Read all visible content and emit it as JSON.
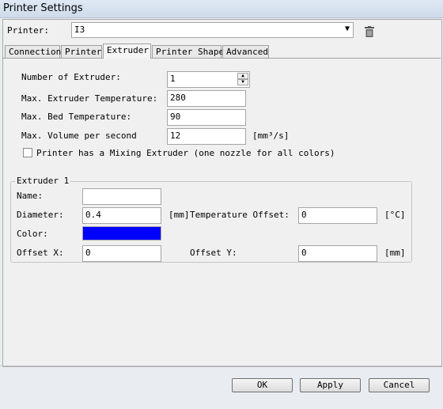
{
  "window": {
    "title": "Printer Settings"
  },
  "printer": {
    "label": "Printer:",
    "selected": "I3"
  },
  "tabs": [
    "Connection",
    "Printer",
    "Extruder",
    "Printer Shape",
    "Advanced"
  ],
  "active_tab": "Extruder",
  "extruder": {
    "count_label": "Number of Extruder:",
    "count_value": "1",
    "max_temp_label": "Max. Extruder Temperature:",
    "max_temp_value": "280",
    "max_bed_label": "Max. Bed Temperature:",
    "max_bed_value": "90",
    "max_volume_label": "Max. Volume per second",
    "max_volume_value": "12",
    "max_volume_unit": "[mm³/s]",
    "mixing_label": "Printer has a Mixing Extruder (one nozzle for all colors)",
    "mixing_checked": false
  },
  "extruder1": {
    "title": "Extruder 1",
    "name_label": "Name:",
    "name_value": "",
    "diameter_label": "Diameter:",
    "diameter_value": "0.4",
    "diameter_unit": "[mm]",
    "temp_offset_label": "Temperature Offset:",
    "temp_offset_value": "0",
    "temp_offset_unit": "[°C]",
    "color_label": "Color:",
    "color_value": "#0000ff",
    "offset_x_label": "Offset X:",
    "offset_x_value": "0",
    "offset_y_label": "Offset Y:",
    "offset_y_value": "0",
    "offset_unit": "[mm]"
  },
  "buttons": {
    "ok": "OK",
    "apply": "Apply",
    "cancel": "Cancel"
  }
}
